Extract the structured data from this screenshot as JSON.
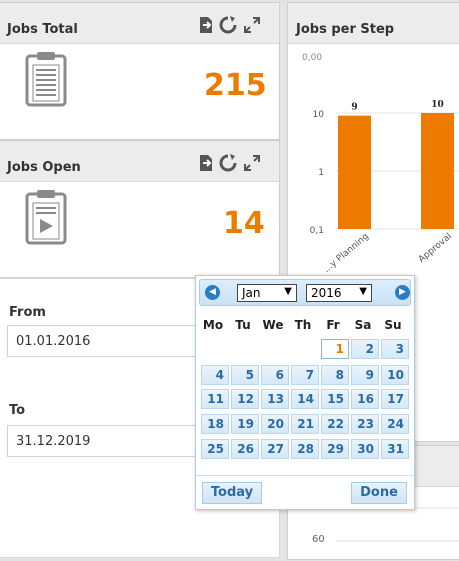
{
  "jobs_total": {
    "title": "Jobs Total",
    "value": "215"
  },
  "jobs_open": {
    "title": "Jobs Open",
    "value": "14"
  },
  "jobs_per_step": {
    "title": "Jobs per Step",
    "lower_panel_tick": "60"
  },
  "chart_data": {
    "type": "bar",
    "title": "Jobs per Step",
    "categories": [
      "...y Planning",
      "Approval"
    ],
    "values": [
      9,
      10
    ],
    "data_labels": [
      "9",
      "10"
    ],
    "y_scale": "log",
    "y_ticks": [
      "10",
      "1",
      "0,1"
    ],
    "ylim": [
      0.1,
      10
    ],
    "bar_color": "#ee7a00",
    "grid": true,
    "zoom_icon_label": "0,00"
  },
  "filters": {
    "from_label": "From",
    "from_value": "01.01.2016",
    "to_label": "To",
    "to_value": "31.12.2019"
  },
  "datepicker": {
    "month": "Jan",
    "year": "2016",
    "prev_icon": "prev-icon",
    "next_icon": "next-icon",
    "weekdays": [
      "Mo",
      "Tu",
      "We",
      "Th",
      "Fr",
      "Sa",
      "Su"
    ],
    "selected_day": "1",
    "week1": [
      "1",
      "2",
      "3"
    ],
    "week2": [
      "4",
      "5",
      "6",
      "7",
      "8",
      "9",
      "10"
    ],
    "week3": [
      "11",
      "12",
      "13",
      "14",
      "15",
      "16",
      "17"
    ],
    "week4": [
      "18",
      "19",
      "20",
      "21",
      "22",
      "23",
      "24"
    ],
    "week5": [
      "25",
      "26",
      "27",
      "28",
      "29",
      "30",
      "31"
    ],
    "today_label": "Today",
    "done_label": "Done"
  },
  "icons": {
    "export": "export-icon",
    "refresh": "refresh-icon",
    "expand": "expand-icon",
    "clipboard": "clipboard-icon",
    "clipboard_play": "clipboard-play-icon"
  },
  "colors": {
    "accent": "#ee7a00",
    "picker_blue": "#2b7cc4"
  }
}
